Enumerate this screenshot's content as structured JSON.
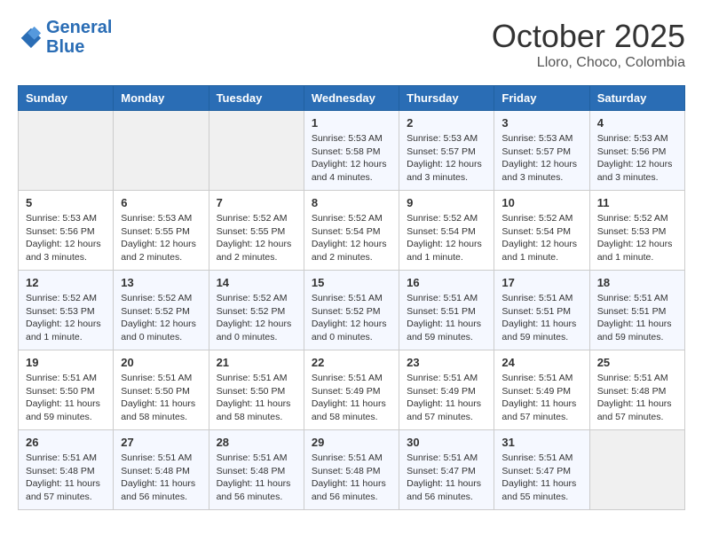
{
  "header": {
    "logo_line1": "General",
    "logo_line2": "Blue",
    "month": "October 2025",
    "location": "Lloro, Choco, Colombia"
  },
  "weekdays": [
    "Sunday",
    "Monday",
    "Tuesday",
    "Wednesday",
    "Thursday",
    "Friday",
    "Saturday"
  ],
  "weeks": [
    [
      {
        "day": "",
        "info": ""
      },
      {
        "day": "",
        "info": ""
      },
      {
        "day": "",
        "info": ""
      },
      {
        "day": "1",
        "info": "Sunrise: 5:53 AM\nSunset: 5:58 PM\nDaylight: 12 hours\nand 4 minutes."
      },
      {
        "day": "2",
        "info": "Sunrise: 5:53 AM\nSunset: 5:57 PM\nDaylight: 12 hours\nand 3 minutes."
      },
      {
        "day": "3",
        "info": "Sunrise: 5:53 AM\nSunset: 5:57 PM\nDaylight: 12 hours\nand 3 minutes."
      },
      {
        "day": "4",
        "info": "Sunrise: 5:53 AM\nSunset: 5:56 PM\nDaylight: 12 hours\nand 3 minutes."
      }
    ],
    [
      {
        "day": "5",
        "info": "Sunrise: 5:53 AM\nSunset: 5:56 PM\nDaylight: 12 hours\nand 3 minutes."
      },
      {
        "day": "6",
        "info": "Sunrise: 5:53 AM\nSunset: 5:55 PM\nDaylight: 12 hours\nand 2 minutes."
      },
      {
        "day": "7",
        "info": "Sunrise: 5:52 AM\nSunset: 5:55 PM\nDaylight: 12 hours\nand 2 minutes."
      },
      {
        "day": "8",
        "info": "Sunrise: 5:52 AM\nSunset: 5:54 PM\nDaylight: 12 hours\nand 2 minutes."
      },
      {
        "day": "9",
        "info": "Sunrise: 5:52 AM\nSunset: 5:54 PM\nDaylight: 12 hours\nand 1 minute."
      },
      {
        "day": "10",
        "info": "Sunrise: 5:52 AM\nSunset: 5:54 PM\nDaylight: 12 hours\nand 1 minute."
      },
      {
        "day": "11",
        "info": "Sunrise: 5:52 AM\nSunset: 5:53 PM\nDaylight: 12 hours\nand 1 minute."
      }
    ],
    [
      {
        "day": "12",
        "info": "Sunrise: 5:52 AM\nSunset: 5:53 PM\nDaylight: 12 hours\nand 1 minute."
      },
      {
        "day": "13",
        "info": "Sunrise: 5:52 AM\nSunset: 5:52 PM\nDaylight: 12 hours\nand 0 minutes."
      },
      {
        "day": "14",
        "info": "Sunrise: 5:52 AM\nSunset: 5:52 PM\nDaylight: 12 hours\nand 0 minutes."
      },
      {
        "day": "15",
        "info": "Sunrise: 5:51 AM\nSunset: 5:52 PM\nDaylight: 12 hours\nand 0 minutes."
      },
      {
        "day": "16",
        "info": "Sunrise: 5:51 AM\nSunset: 5:51 PM\nDaylight: 11 hours\nand 59 minutes."
      },
      {
        "day": "17",
        "info": "Sunrise: 5:51 AM\nSunset: 5:51 PM\nDaylight: 11 hours\nand 59 minutes."
      },
      {
        "day": "18",
        "info": "Sunrise: 5:51 AM\nSunset: 5:51 PM\nDaylight: 11 hours\nand 59 minutes."
      }
    ],
    [
      {
        "day": "19",
        "info": "Sunrise: 5:51 AM\nSunset: 5:50 PM\nDaylight: 11 hours\nand 59 minutes."
      },
      {
        "day": "20",
        "info": "Sunrise: 5:51 AM\nSunset: 5:50 PM\nDaylight: 11 hours\nand 58 minutes."
      },
      {
        "day": "21",
        "info": "Sunrise: 5:51 AM\nSunset: 5:50 PM\nDaylight: 11 hours\nand 58 minutes."
      },
      {
        "day": "22",
        "info": "Sunrise: 5:51 AM\nSunset: 5:49 PM\nDaylight: 11 hours\nand 58 minutes."
      },
      {
        "day": "23",
        "info": "Sunrise: 5:51 AM\nSunset: 5:49 PM\nDaylight: 11 hours\nand 57 minutes."
      },
      {
        "day": "24",
        "info": "Sunrise: 5:51 AM\nSunset: 5:49 PM\nDaylight: 11 hours\nand 57 minutes."
      },
      {
        "day": "25",
        "info": "Sunrise: 5:51 AM\nSunset: 5:48 PM\nDaylight: 11 hours\nand 57 minutes."
      }
    ],
    [
      {
        "day": "26",
        "info": "Sunrise: 5:51 AM\nSunset: 5:48 PM\nDaylight: 11 hours\nand 57 minutes."
      },
      {
        "day": "27",
        "info": "Sunrise: 5:51 AM\nSunset: 5:48 PM\nDaylight: 11 hours\nand 56 minutes."
      },
      {
        "day": "28",
        "info": "Sunrise: 5:51 AM\nSunset: 5:48 PM\nDaylight: 11 hours\nand 56 minutes."
      },
      {
        "day": "29",
        "info": "Sunrise: 5:51 AM\nSunset: 5:48 PM\nDaylight: 11 hours\nand 56 minutes."
      },
      {
        "day": "30",
        "info": "Sunrise: 5:51 AM\nSunset: 5:47 PM\nDaylight: 11 hours\nand 56 minutes."
      },
      {
        "day": "31",
        "info": "Sunrise: 5:51 AM\nSunset: 5:47 PM\nDaylight: 11 hours\nand 55 minutes."
      },
      {
        "day": "",
        "info": ""
      }
    ]
  ]
}
